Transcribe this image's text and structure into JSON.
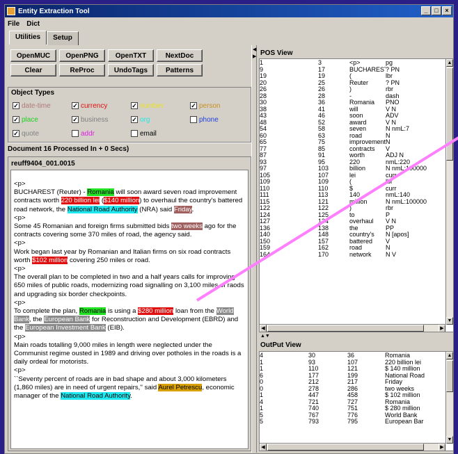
{
  "window": {
    "title": "Entity Extraction Tool"
  },
  "menu": [
    "File",
    "Dict"
  ],
  "tabs": [
    "Utilities",
    "Setup"
  ],
  "buttons": [
    "OpenMUC",
    "OpenPNG",
    "OpenTXT",
    "NextDoc",
    "Patterns",
    "Clear",
    "ReProc",
    "UndoTags"
  ],
  "object_types": {
    "title": "Object Types",
    "items": [
      {
        "label": "date-time",
        "checked": true,
        "color": "#b07878"
      },
      {
        "label": "currency",
        "checked": true,
        "color": "#e01010"
      },
      {
        "label": "number",
        "checked": true,
        "color": "#e8e020"
      },
      {
        "label": "person",
        "checked": true,
        "color": "#c89020"
      },
      {
        "label": "place",
        "checked": true,
        "color": "#20d020"
      },
      {
        "label": "business",
        "checked": true,
        "color": "#808080"
      },
      {
        "label": "org",
        "checked": true,
        "color": "#20e8e8"
      },
      {
        "label": "phone",
        "checked": false,
        "color": "#2040e0"
      },
      {
        "label": "quote",
        "checked": true,
        "color": "#808080"
      },
      {
        "label": "addr",
        "checked": false,
        "color": "#e020e0"
      },
      {
        "label": "email",
        "checked": false,
        "color": "#000000"
      }
    ]
  },
  "status": "Document 16 Processed In + 0 Secs)",
  "doc": {
    "title": "reuff9404_001.0015",
    "p": "<p>",
    "s1": [
      "   BUCHAREST (Reuter) - ",
      "Romania",
      " will soon award seven road improvement contracts worth ",
      "220 billion lei",
      " (",
      "$140 million",
      ") to overhaul the country's battered road network, the ",
      "National Road Authority",
      " (NRA) said ",
      "Friday",
      "."
    ],
    "s2": [
      "   Some 45 Romanian and foreign firms submitted bids ",
      "two weeks",
      " ago for the contracts covering some 370 miles of road, the agency said."
    ],
    "s3": [
      "   Work began last year by Romanian and Italian firms on six road contracts worth ",
      "$102 million",
      " covering 250 miles or road."
    ],
    "s4": "   The overall plan to be completed in two and a half years calls for improving 650 miles of public roads, modernizing road signalling on 3,100 miles of raods and upgrading six border checkpoints.",
    "s5": [
      "   To complete the plan, ",
      "Romania",
      " is using a ",
      "$280 million",
      " loan from the ",
      "World Bank",
      ", the ",
      "European Bank",
      " for Reconstruction and Development (EBRD) and the ",
      "European Investment Bank",
      " (EIB)."
    ],
    "s6": "   Main roads totalling 9,000 miles in length were neglected under the Communist regime ousted in 1989 and driving over potholes in the roads is a daily ordeal for motorists.",
    "s7": [
      "   ``Seventy percent of roads are in bad shape and about 3,000 kilometers (1,860 miles) are in need of urgent repairs,'' said ",
      "Aurel Petrescu",
      ", economic manager of the ",
      "National Road Authority",
      "."
    ]
  },
  "pos_view": {
    "title": "POS View",
    "rows": [
      [
        "1",
        "3",
        "<p>",
        "pg"
      ],
      [
        "9",
        "17",
        "BUCHAREST",
        "? PN"
      ],
      [
        "19",
        "19",
        "(",
        "lbr"
      ],
      [
        "20",
        "25",
        "Reuter",
        "? PN"
      ],
      [
        "26",
        "26",
        ")",
        "rbr"
      ],
      [
        "28",
        "28",
        "-",
        "dash"
      ],
      [
        "30",
        "36",
        "Romania",
        "PNO"
      ],
      [
        "38",
        "41",
        "will",
        "V N"
      ],
      [
        "43",
        "46",
        "soon",
        "ADV"
      ],
      [
        "48",
        "52",
        "award",
        "V N"
      ],
      [
        "54",
        "58",
        "seven",
        "N nmL:7"
      ],
      [
        "60",
        "63",
        "road",
        "N"
      ],
      [
        "65",
        "75",
        "improvement",
        "N"
      ],
      [
        "77",
        "85",
        "contracts",
        "V"
      ],
      [
        "87",
        "91",
        "worth",
        "ADJ N"
      ],
      [
        "93",
        "95",
        "220",
        "nmL:220"
      ],
      [
        "97",
        "103",
        "billion",
        "N nmL:100000"
      ],
      [
        "105",
        "107",
        "lei",
        "curr"
      ],
      [
        "109",
        "109",
        "(",
        "lbr"
      ],
      [
        "110",
        "110",
        "$",
        "curr"
      ],
      [
        "111",
        "113",
        "140",
        "nmL:140"
      ],
      [
        "115",
        "121",
        "million",
        "N nmL:100000"
      ],
      [
        "122",
        "122",
        ")",
        "rbr"
      ],
      [
        "124",
        "125",
        "to",
        "P"
      ],
      [
        "127",
        "134",
        "overhaul",
        "V N"
      ],
      [
        "136",
        "138",
        "the",
        "PP"
      ],
      [
        "140",
        "148",
        "country's",
        "N [apos]"
      ],
      [
        "150",
        "157",
        "battered",
        "V"
      ],
      [
        "159",
        "162",
        "road",
        "N"
      ],
      [
        "164",
        "170",
        "network",
        "N V"
      ]
    ]
  },
  "output_view": {
    "title": "OutPut View",
    "rows": [
      [
        "4",
        "30",
        "36",
        "Romania"
      ],
      [
        "1",
        "93",
        "107",
        "220 billion lei"
      ],
      [
        "1",
        "110",
        "121",
        "$ 140 million"
      ],
      [
        "6",
        "177",
        "199",
        "National Road"
      ],
      [
        "0",
        "212",
        "217",
        "Friday"
      ],
      [
        "0",
        "278",
        "286",
        "two weeks"
      ],
      [
        "1",
        "447",
        "458",
        "$ 102 million"
      ],
      [
        "4",
        "721",
        "727",
        "Romania"
      ],
      [
        "1",
        "740",
        "751",
        "$ 280 million"
      ],
      [
        "5",
        "767",
        "776",
        "World Bank"
      ],
      [
        "5",
        "793",
        "795",
        "European Bar"
      ]
    ]
  }
}
